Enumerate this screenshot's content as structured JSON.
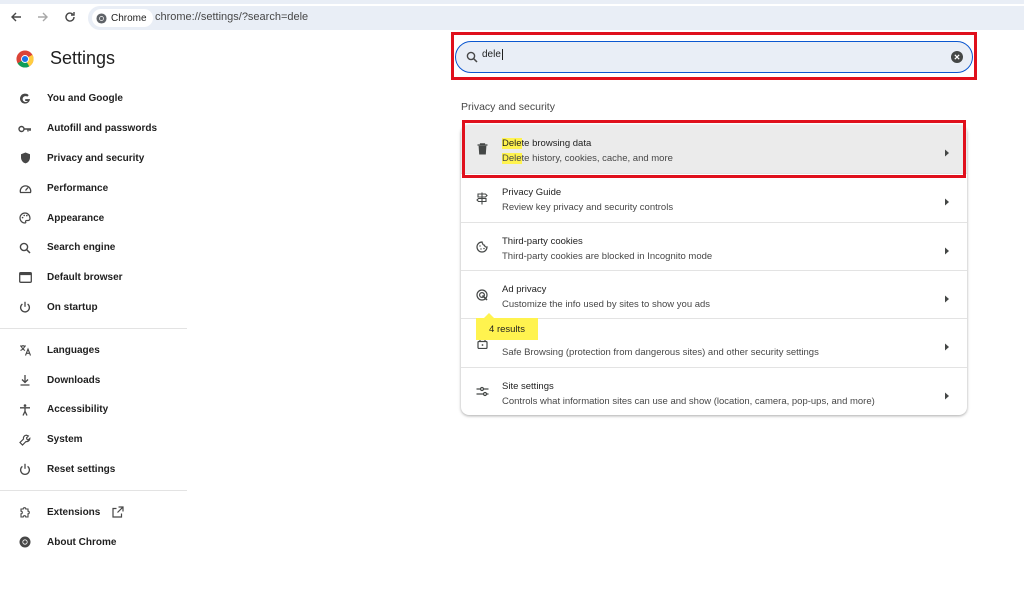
{
  "browser": {
    "chip_label": "Chrome",
    "url": "chrome://settings/?search=dele"
  },
  "settings_title": "Settings",
  "nav": {
    "group1": [
      {
        "label": "You and Google",
        "icon": "google-g-icon"
      },
      {
        "label": "Autofill and passwords",
        "icon": "key-icon"
      },
      {
        "label": "Privacy and security",
        "icon": "shield-icon"
      },
      {
        "label": "Performance",
        "icon": "speedometer-icon"
      },
      {
        "label": "Appearance",
        "icon": "palette-icon"
      },
      {
        "label": "Search engine",
        "icon": "search-icon"
      },
      {
        "label": "Default browser",
        "icon": "browser-window-icon"
      },
      {
        "label": "On startup",
        "icon": "power-icon"
      }
    ],
    "group2": [
      {
        "label": "Languages",
        "icon": "translate-icon"
      },
      {
        "label": "Downloads",
        "icon": "download-icon"
      },
      {
        "label": "Accessibility",
        "icon": "accessibility-icon"
      },
      {
        "label": "System",
        "icon": "wrench-icon"
      },
      {
        "label": "Reset settings",
        "icon": "reset-icon"
      }
    ],
    "group3": [
      {
        "label": "Extensions",
        "icon": "puzzle-icon"
      },
      {
        "label": "About Chrome",
        "icon": "chrome-logo-icon"
      }
    ]
  },
  "search": {
    "value": "dele"
  },
  "section_title": "Privacy and security",
  "rows": [
    {
      "primary_hl": "Dele",
      "primary_rest": "te browsing data",
      "secondary_hl": "Dele",
      "secondary_rest": "te history, cookies, cache, and more",
      "icon": "trash-icon"
    },
    {
      "primary": "Privacy Guide",
      "secondary": "Review key privacy and security controls",
      "icon": "signpost-icon"
    },
    {
      "primary": "Third-party cookies",
      "secondary": "Third-party cookies are blocked in Incognito mode",
      "icon": "cookie-icon"
    },
    {
      "primary": "Ad privacy",
      "secondary": "Customize the info used by sites to show you ads",
      "icon": "ad-privacy-icon"
    },
    {
      "primary": "",
      "secondary": "Safe Browsing (protection from dangerous sites) and other security settings",
      "icon": "lock-icon"
    },
    {
      "primary": "Site settings",
      "secondary": "Controls what information sites can use and show (location, camera, pop-ups, and more)",
      "icon": "sliders-icon"
    }
  ],
  "results_badge": "4 results",
  "colors": {
    "highlight": "#fff34f",
    "annotation_red": "#e0101c",
    "accent_blue": "#0b57d0"
  }
}
